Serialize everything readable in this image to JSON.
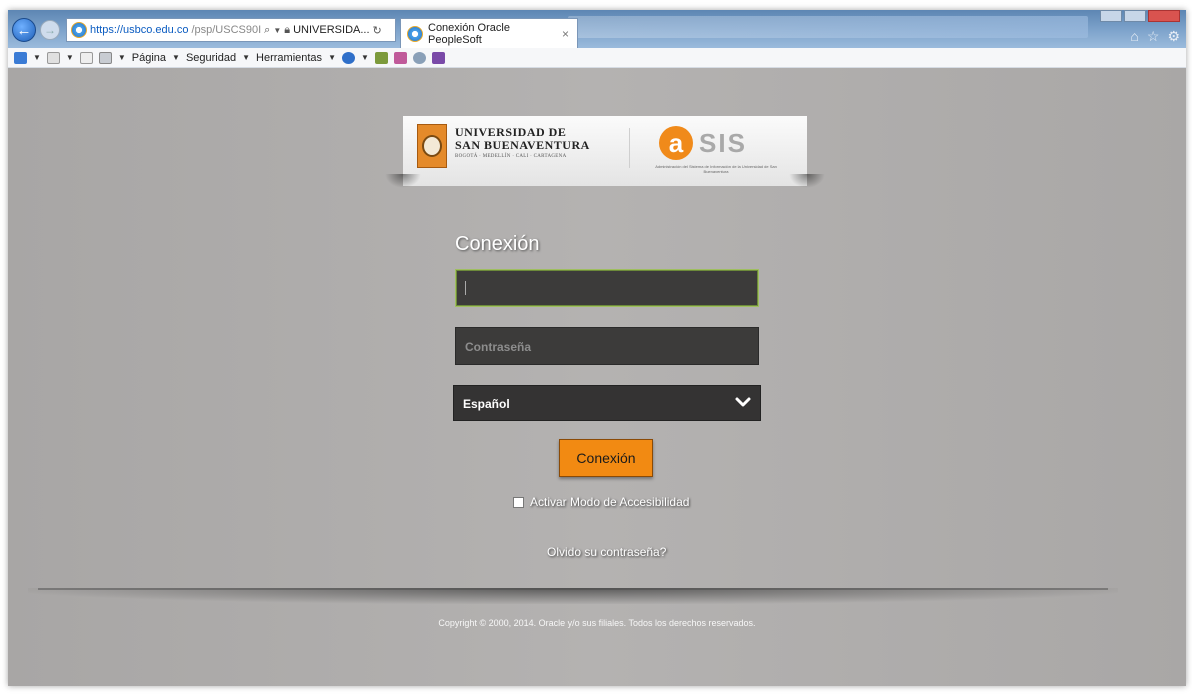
{
  "browser": {
    "address_host": "https://usbco.edu.co",
    "address_path": "/psp/USCS90I",
    "address_site": "UNIVERSIDA...",
    "tab_title": "Conexión Oracle PeopleSoft",
    "tab_close": "×"
  },
  "commandbar": {
    "pagina": "Página",
    "seguridad": "Seguridad",
    "herramientas": "Herramientas"
  },
  "banner": {
    "uni_line1": "UNIVERSIDAD DE",
    "uni_line2": "SAN BUENAVENTURA",
    "uni_line3": "BOGOTÁ · MEDELLÍN · CALI · CARTAGENA",
    "asis_letter": "a",
    "asis_text": "SIS",
    "asis_sub": "Administración del Sistema de Información de la Universidad de San Buenaventura"
  },
  "login": {
    "title": "Conexión",
    "user_value": "",
    "password_placeholder": "Contraseña",
    "language_selected": "Español",
    "submit_label": "Conexión",
    "accessibility_label": "Activar Modo de Accesibilidad",
    "forgot_label": "Olvido su contraseña?"
  },
  "footer": {
    "copyright": "Copyright © 2000, 2014. Oracle y/o sus filiales. Todos los derechos reservados."
  },
  "colors": {
    "accent": "#f28a12",
    "field_bg": "#3c3b3a",
    "page_bg": "#b0aead"
  }
}
